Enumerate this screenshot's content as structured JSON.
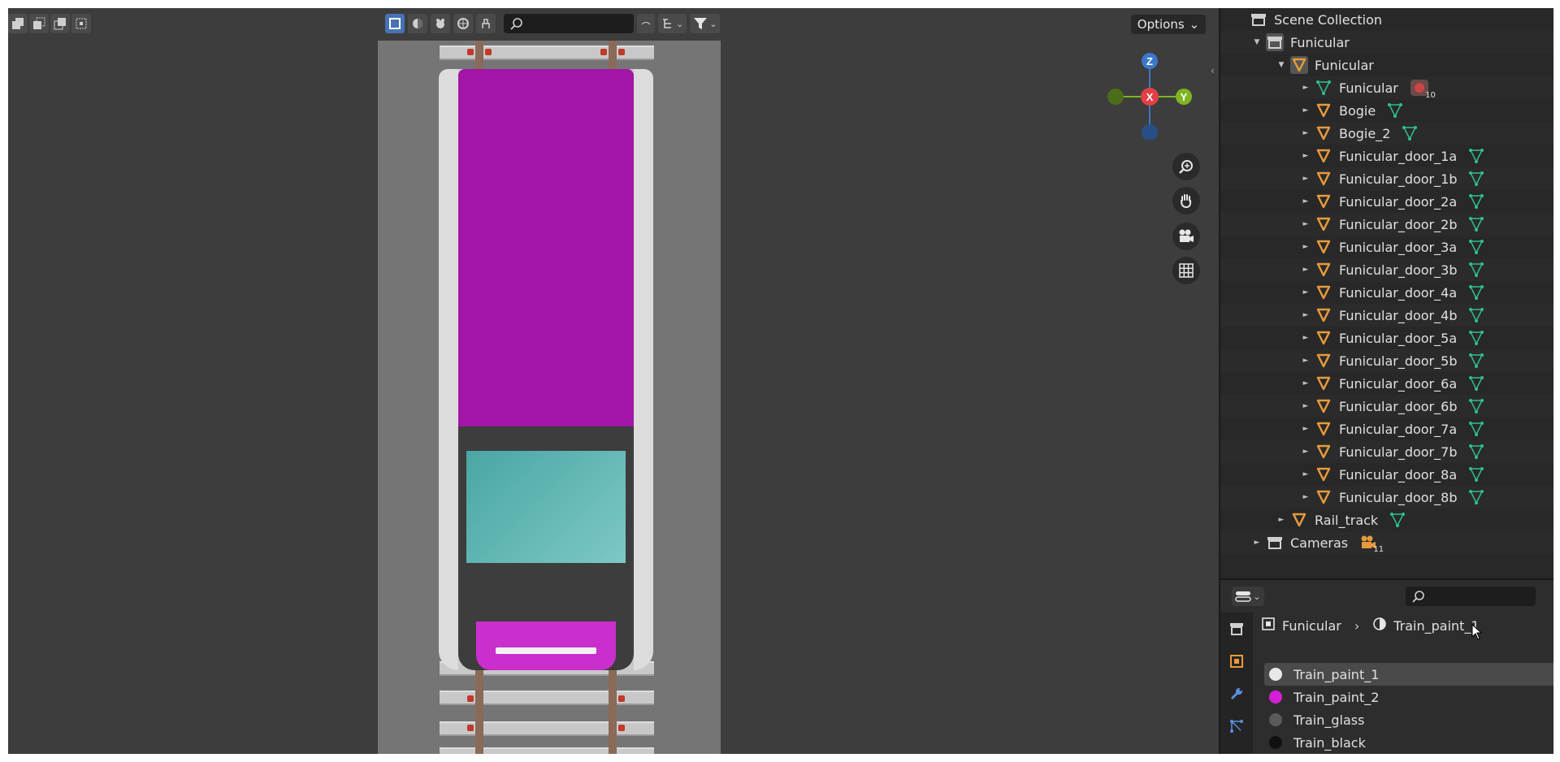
{
  "viewport": {
    "options_label": "Options",
    "colors": {
      "roof": "#a315a6",
      "glass": "#5fb6b4",
      "nose": "#c92fcc",
      "bg": "#3d3d3d"
    }
  },
  "gizmo": {
    "z": "Z",
    "x": "X",
    "y": "Y"
  },
  "outliner": {
    "root": "Scene Collection",
    "rows": [
      {
        "label": "Funicular",
        "icon": "collection-icon",
        "extra": null
      },
      {
        "label": "Funicular",
        "icon": "object-icon",
        "extra": null
      },
      {
        "label": "Funicular",
        "icon": "mesh-data-icon",
        "extra": "modifier-icon",
        "badge": "10"
      },
      {
        "label": "Bogie",
        "icon": "object-icon",
        "extra": "mesh-data-icon"
      },
      {
        "label": "Bogie_2",
        "icon": "object-icon",
        "extra": "mesh-data-icon"
      },
      {
        "label": "Funicular_door_1a",
        "icon": "object-icon",
        "extra": "mesh-data-icon"
      },
      {
        "label": "Funicular_door_1b",
        "icon": "object-icon",
        "extra": "mesh-data-icon"
      },
      {
        "label": "Funicular_door_2a",
        "icon": "object-icon",
        "extra": "mesh-data-icon"
      },
      {
        "label": "Funicular_door_2b",
        "icon": "object-icon",
        "extra": "mesh-data-icon"
      },
      {
        "label": "Funicular_door_3a",
        "icon": "object-icon",
        "extra": "mesh-data-icon"
      },
      {
        "label": "Funicular_door_3b",
        "icon": "object-icon",
        "extra": "mesh-data-icon"
      },
      {
        "label": "Funicular_door_4a",
        "icon": "object-icon",
        "extra": "mesh-data-icon"
      },
      {
        "label": "Funicular_door_4b",
        "icon": "object-icon",
        "extra": "mesh-data-icon"
      },
      {
        "label": "Funicular_door_5a",
        "icon": "object-icon",
        "extra": "mesh-data-icon"
      },
      {
        "label": "Funicular_door_5b",
        "icon": "object-icon",
        "extra": "mesh-data-icon"
      },
      {
        "label": "Funicular_door_6a",
        "icon": "object-icon",
        "extra": "mesh-data-icon"
      },
      {
        "label": "Funicular_door_6b",
        "icon": "object-icon",
        "extra": "mesh-data-icon"
      },
      {
        "label": "Funicular_door_7a",
        "icon": "object-icon",
        "extra": "mesh-data-icon"
      },
      {
        "label": "Funicular_door_7b",
        "icon": "object-icon",
        "extra": "mesh-data-icon"
      },
      {
        "label": "Funicular_door_8a",
        "icon": "object-icon",
        "extra": "mesh-data-icon"
      },
      {
        "label": "Funicular_door_8b",
        "icon": "object-icon",
        "extra": "mesh-data-icon"
      },
      {
        "label": "Rail_track",
        "icon": "object-icon",
        "extra": "mesh-data-icon"
      },
      {
        "label": "Cameras",
        "icon": "collection-icon",
        "extra": "camera-icon",
        "badge": "11"
      }
    ]
  },
  "properties": {
    "breadcrumb": {
      "object": "Funicular",
      "material": "Train_paint_1"
    },
    "materials": [
      {
        "label": "Train_paint_1",
        "color": "#e8e8e8"
      },
      {
        "label": "Train_paint_2",
        "color": "#d31fd6"
      },
      {
        "label": "Train_glass",
        "color": "#5a5a5a"
      },
      {
        "label": "Train_black",
        "color": "#111111"
      }
    ]
  }
}
